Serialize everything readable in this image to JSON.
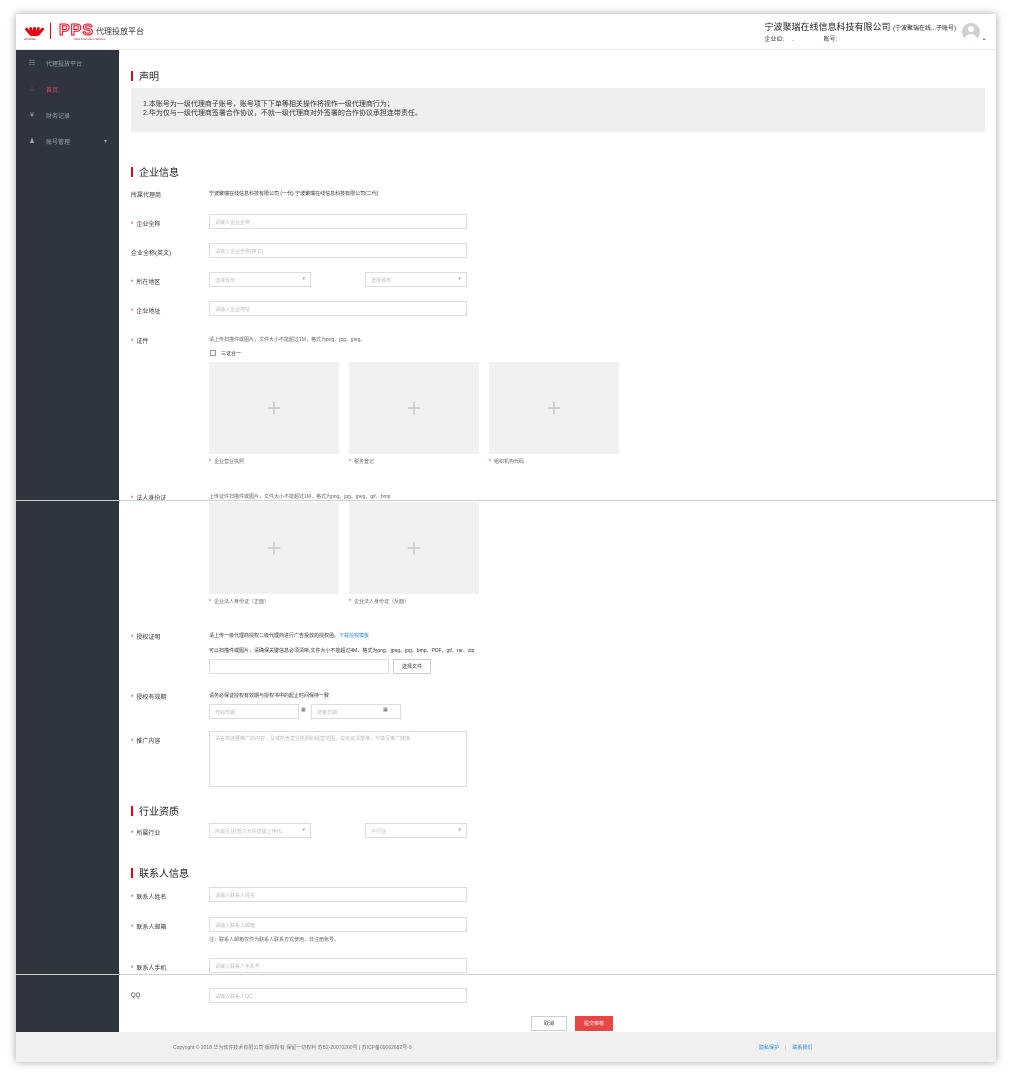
{
  "header": {
    "huawei_label": "HUAWEI",
    "pps_logo": "PPS",
    "pps_sub": "Paid Promotion Service",
    "platform": "代理投放平台",
    "company_name": "宁波聚瑞在线信息科技有限公司",
    "company_account": "(宁波聚瑞在线...子账号)",
    "enterprise_id_label": "企业ID:",
    "enterprise_id_value": ".",
    "account_label": "账号:",
    "avatar_icon": "user-avatar-icon"
  },
  "sidebar": {
    "title": "代理投放平台",
    "items": [
      {
        "label": "首页",
        "icon": "home-icon"
      },
      {
        "label": "财务记录",
        "icon": "yen-icon"
      },
      {
        "label": "账号管理",
        "icon": "user-icon"
      }
    ]
  },
  "notice": {
    "title": "声明",
    "line1": "1.本账号为一级代理商子账号，账号项下下单等相关操作将视作一级代理商行为；",
    "line2": "2.华为仅与一级代理商签署合作协议，不就一级代理商对外签署的合作协议承担连带责任。"
  },
  "enterprise": {
    "title": "企业信息",
    "agent_label": "所属代理商",
    "agent_value": "宁波聚瑞在线信息科技有限公司 (一代)  宁波聚瑞在线信息科技有限公司(二代)",
    "name_label": "企业全称",
    "name_placeholder": "请输入企业全称",
    "name_en_label": "企业全称(英文)",
    "name_en_placeholder": "请输入企业全称(英文)",
    "region_label": "所在地区",
    "province_placeholder": "选择省份",
    "city_placeholder": "选择城市",
    "address_label": "企业地址",
    "address_placeholder": "请输入企业地址",
    "cert_label": "证件",
    "cert_hint": "请上传扫描件或图片，文件大小不能超过1M，格式为png、jpg、jpeg。",
    "three_in_one": "三证合一",
    "upload_business": "企业营业执照",
    "upload_tax": "税务登记",
    "upload_org": "组织机构代码",
    "legal_label": "法人身份证",
    "legal_hint": "上传证件扫描件或图片，文件大小不能超过1M，格式为png、jpg、jpeg、gif、bmp",
    "legal_front": "企业法人身份证（正面）",
    "legal_back": "企业法人身份证（反面）",
    "auth_label": "授权证明",
    "auth_hint1": "请上传一级代理商授权二级代理商进行广告投放的授权函。",
    "auth_download": "下载授权模板",
    "auth_hint2": "可以扫描件或图片，请确保关键信息必须清晰,文件大小不能超过4M，格式为png、jpeg、jpg、bmp、PDF、gif、rar、zip",
    "choose_file": "选择文件",
    "valid_label": "授权有效期",
    "valid_hint": "请务必保证授权有效期与授权书中的起止时间保持一致",
    "start_date": "开始日期",
    "end_date": "结束日期",
    "promo_label": "推广内容",
    "promo_placeholder": "请言简述要推广的内容，及或所含营业执照的经营范围，说完说清楚推，可填写推广链接"
  },
  "industry": {
    "title": "行业资质",
    "label": "所属行业",
    "industry_placeholder": "所属行业(暂只允许直属上传代...",
    "sub_placeholder": "子行业"
  },
  "contact": {
    "title": "联系人信息",
    "name_label": "联系人姓名",
    "name_placeholder": "请输入联系人姓名",
    "email_label": "联系人邮箱",
    "email_placeholder": "请输入联系人邮箱",
    "email_note": "注：联系人邮箱仅作为联系人联系方式使用，非注册账号。",
    "phone_label": "联系人手机",
    "phone_placeholder": "请输入联系人手机号",
    "qq_label": "QQ",
    "qq_placeholder": "请输入联系人QQ"
  },
  "actions": {
    "cancel": "取消",
    "submit": "提交审核"
  },
  "footer": {
    "copyright": "Copyright © 2018 华为软件技术有限公司 版权所有 保留一切权利 苏B2-20070200号 | 苏ICP备09062682号-9",
    "privacy": "隐私保护",
    "contact": "联系我们"
  },
  "colors": {
    "brand_red": "#e60012",
    "sidebar_bg": "#2f343f",
    "link_blue": "#1e88e5"
  }
}
